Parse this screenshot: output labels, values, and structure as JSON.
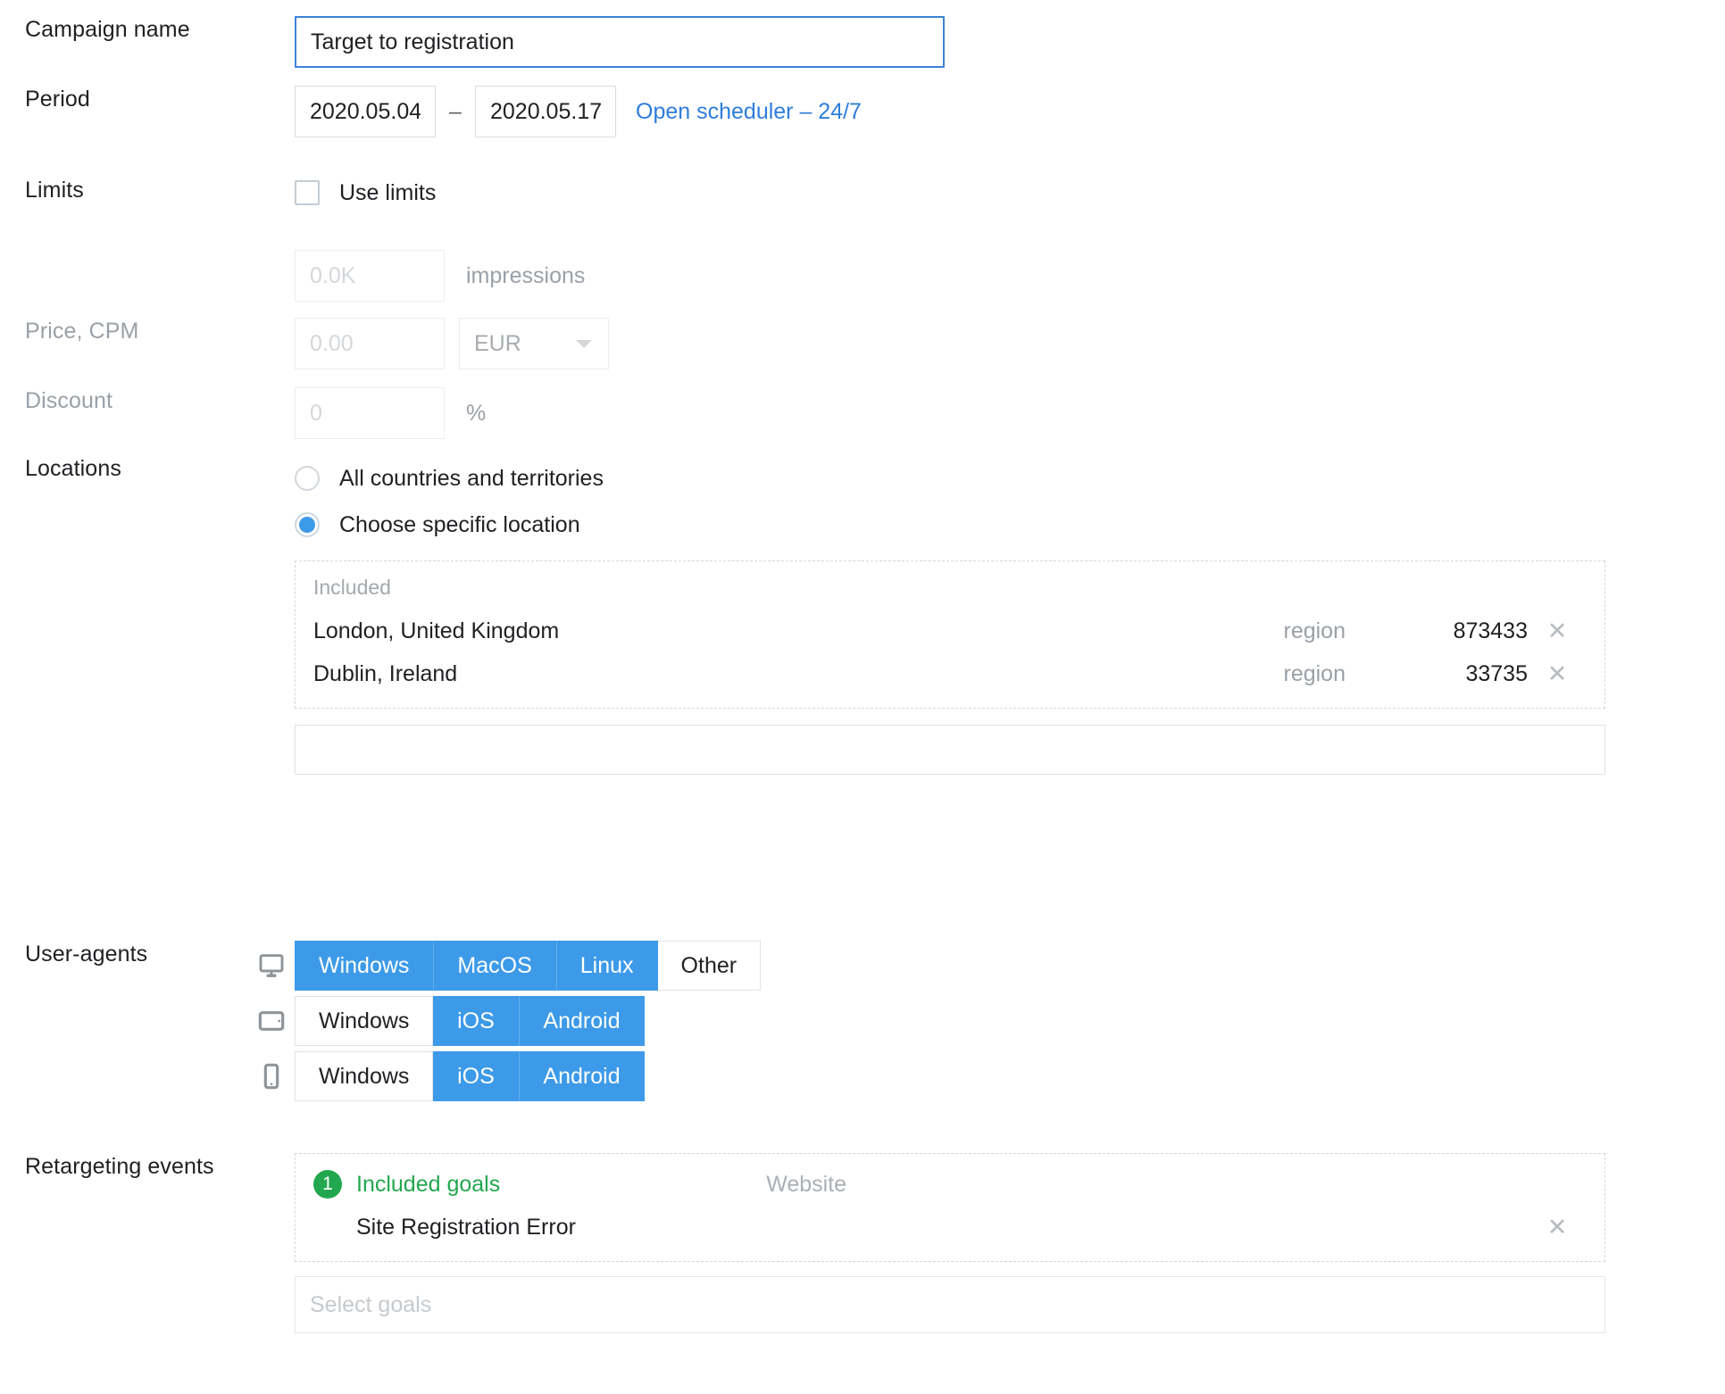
{
  "campaign": {
    "label": "Campaign name",
    "value": "Target to registration",
    "placeholder": ""
  },
  "period": {
    "label": "Period",
    "start": "2020.05.04",
    "end": "2020.05.17",
    "separator": "–",
    "scheduler_link": "Open scheduler – 24/7",
    "link_color": "#2e7ddb"
  },
  "limits": {
    "label": "Limits",
    "use_limits_label": "Use limits",
    "use_limits_checked": false,
    "impressions": {
      "value": "",
      "placeholder": "0.0K",
      "unit": "impressions"
    },
    "price": {
      "label": "Price, CPM",
      "value": "",
      "placeholder": "0.00",
      "currency": "EUR"
    },
    "discount": {
      "label": "Discount",
      "value": "",
      "placeholder": "0",
      "unit": "%"
    }
  },
  "locations": {
    "label": "Locations",
    "options": [
      {
        "label": "All countries and territories",
        "selected": false
      },
      {
        "label": "Choose specific location",
        "selected": true
      }
    ],
    "included_caption": "Included",
    "items": [
      {
        "name": "London, United Kingdom",
        "type": "region",
        "count": "873433",
        "remove": "✕"
      },
      {
        "name": "Dublin, Ireland",
        "type": "region",
        "count": "33735",
        "remove": "✕"
      }
    ],
    "search_placeholder": "",
    "search_value": ""
  },
  "user_agents": {
    "label": "User-agents",
    "rows": [
      {
        "device": "desktop",
        "options": [
          {
            "label": "Windows",
            "active": true
          },
          {
            "label": "MacOS",
            "active": true
          },
          {
            "label": "Linux",
            "active": true
          },
          {
            "label": "Other",
            "active": false
          }
        ]
      },
      {
        "device": "tablet",
        "options": [
          {
            "label": "Windows",
            "active": false
          },
          {
            "label": "iOS",
            "active": true
          },
          {
            "label": "Android",
            "active": true
          }
        ]
      },
      {
        "device": "phone",
        "options": [
          {
            "label": "Windows",
            "active": false
          },
          {
            "label": "iOS",
            "active": true
          },
          {
            "label": "Android",
            "active": true
          }
        ]
      }
    ]
  },
  "retargeting": {
    "label": "Retargeting events",
    "badge_count": "1",
    "included_goals_label": "Included goals",
    "badge_color": "#22a74f",
    "source_label": "Website",
    "goals": [
      {
        "name": "Site Registration Error",
        "remove": "✕"
      }
    ],
    "select_placeholder": "Select goals",
    "select_value": ""
  }
}
